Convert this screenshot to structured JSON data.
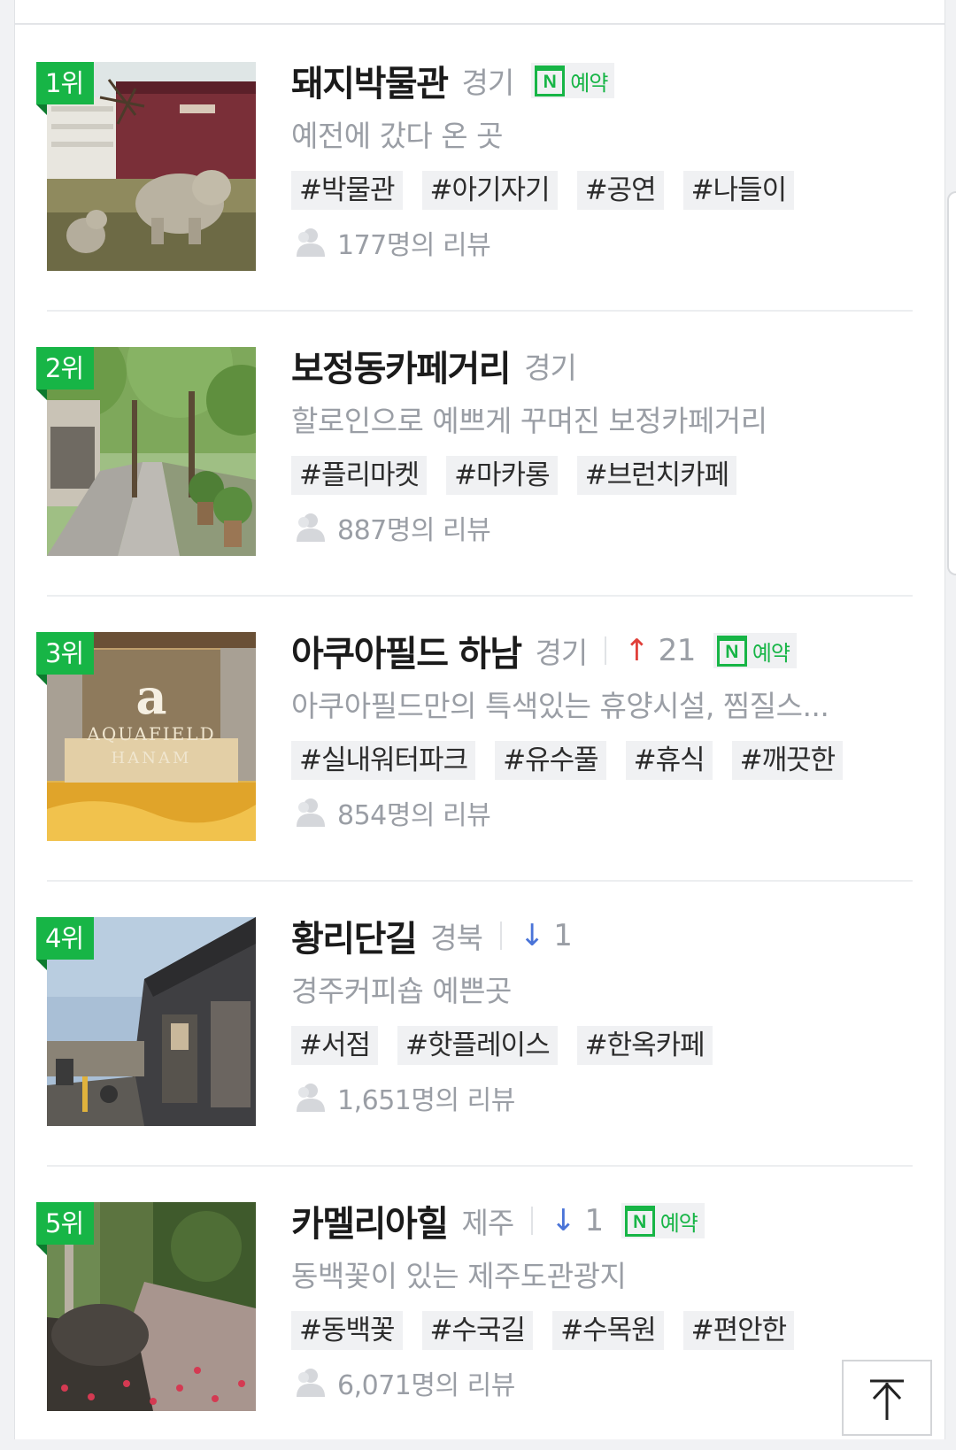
{
  "reserve_label": "예약",
  "reserve_n": "N",
  "items": [
    {
      "rank": "1위",
      "name": "돼지박물관",
      "region": "경기",
      "desc": "예전에 갔다 온 곳",
      "tags": [
        "#박물관",
        "#아기자기",
        "#공연",
        "#나들이"
      ],
      "reviews": "177명의 리뷰",
      "reserve": true,
      "image": "museum-photo"
    },
    {
      "rank": "2위",
      "name": "보정동카페거리",
      "region": "경기",
      "desc": "할로인으로 예쁘게 꾸며진 보정카페거리",
      "tags": [
        "#플리마켓",
        "#마카롱",
        "#브런치카페"
      ],
      "reviews": "887명의 리뷰",
      "reserve": false,
      "image": "cafe-street-photo"
    },
    {
      "rank": "3위",
      "name": "아쿠아필드 하남",
      "region": "경기",
      "change_arrow": "↑",
      "change_value": "21",
      "change_dir": "up",
      "desc": "아쿠아필드만의 특색있는 휴양시설, 찜질스...",
      "tags": [
        "#실내워터파크",
        "#유수풀",
        "#휴식",
        "#깨끗한"
      ],
      "reviews": "854명의 리뷰",
      "reserve": true,
      "image": "aquafield-photo",
      "image_text_logo": "a",
      "image_text_line1": "AQUAFIELD",
      "image_text_line2": "HANAM"
    },
    {
      "rank": "4위",
      "name": "황리단길",
      "region": "경북",
      "change_arrow": "↓",
      "change_value": "1",
      "change_dir": "down",
      "desc": "경주커피숍 예쁜곳",
      "tags": [
        "#서점",
        "#핫플레이스",
        "#한옥카페"
      ],
      "reviews": "1,651명의 리뷰",
      "reserve": false,
      "image": "street-shop-photo"
    },
    {
      "rank": "5위",
      "name": "카멜리아힐",
      "region": "제주",
      "change_arrow": "↓",
      "change_value": "1",
      "change_dir": "down",
      "desc": "동백꽃이 있는 제주도관광지",
      "tags": [
        "#동백꽃",
        "#수국길",
        "#수목원",
        "#편안한"
      ],
      "reviews": "6,071명의 리뷰",
      "reserve": true,
      "image": "camellia-garden-photo"
    }
  ],
  "to_top_icon": "arrow-up-to-top-icon",
  "colors": {
    "rank_badge": "#17b546",
    "rank_up": "#e0403a",
    "rank_down": "#4a74d8",
    "reserve": "#17b546"
  }
}
